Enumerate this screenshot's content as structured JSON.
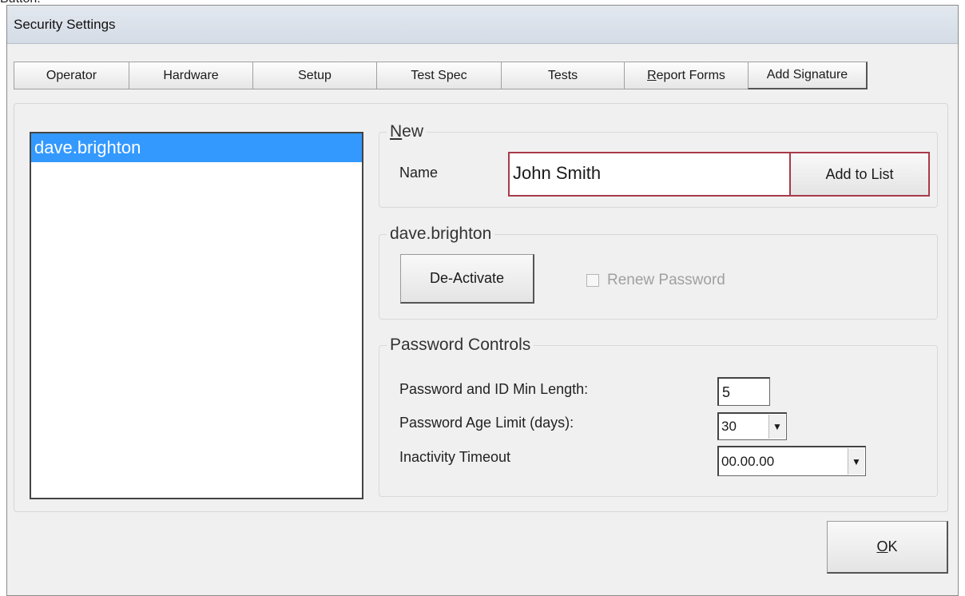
{
  "caption": "Button:",
  "window": {
    "title": "Security Settings"
  },
  "tabs": [
    {
      "label": "Operator"
    },
    {
      "label": "Hardware"
    },
    {
      "label": "Setup"
    },
    {
      "label": "Test Spec"
    },
    {
      "label": "Tests"
    },
    {
      "label": "Report Forms"
    },
    {
      "label": "Add Signature"
    }
  ],
  "user_list": {
    "items": [
      "dave.brighton"
    ],
    "selected": "dave.brighton"
  },
  "new_group": {
    "title": "New",
    "name_label": "Name",
    "name_value": "John Smith",
    "add_button": "Add to List"
  },
  "user_group": {
    "title": "dave.brighton",
    "deactivate_button": "De-Activate",
    "renew_password_label": "Renew Password",
    "renew_password_checked": false,
    "renew_password_enabled": false
  },
  "password_controls": {
    "title": "Password Controls",
    "min_length_label": "Password and ID Min Length:",
    "min_length_value": "5",
    "age_limit_label": "Password Age Limit (days):",
    "age_limit_value": "30",
    "inactivity_label": "Inactivity Timeout",
    "inactivity_value": "00.00.00"
  },
  "ok_button": "OK",
  "colors": {
    "selection": "#3399ff",
    "focus_border": "#a83a4a"
  }
}
